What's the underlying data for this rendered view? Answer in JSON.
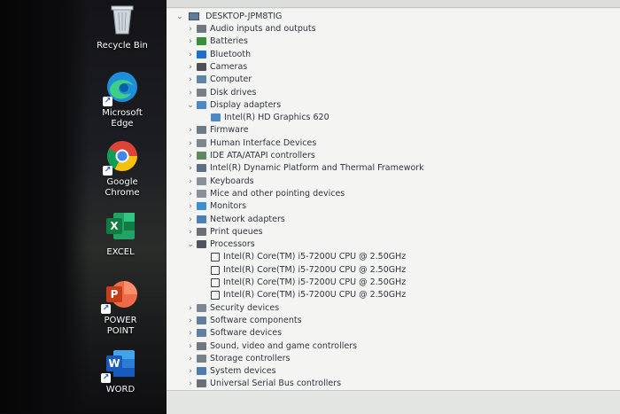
{
  "desktop": {
    "icons": [
      {
        "label": "Recycle Bin",
        "icon": "recycle-bin-icon"
      },
      {
        "label": "Microsoft Edge",
        "icon": "edge-icon"
      },
      {
        "label": "Google Chrome",
        "icon": "chrome-icon"
      },
      {
        "label": "EXCEL",
        "icon": "excel-icon"
      },
      {
        "label": "POWER POINT",
        "icon": "powerpoint-icon"
      },
      {
        "label": "WORD",
        "icon": "word-icon"
      }
    ],
    "edge_lines": [
      "Microsoft",
      "Edge"
    ],
    "chrome_lines": [
      "Google",
      "Chrome"
    ],
    "pp_lines": [
      "POWER",
      "POINT"
    ],
    "excel_letter": "X",
    "pp_letter": "P",
    "word_letter": "W"
  },
  "device_manager": {
    "root": "DESKTOP-JPM8TIG",
    "categories": [
      {
        "label": "Audio inputs and outputs",
        "icon": "speaker-icon",
        "expanded": false
      },
      {
        "label": "Batteries",
        "icon": "battery-icon",
        "expanded": false
      },
      {
        "label": "Bluetooth",
        "icon": "bluetooth-icon",
        "expanded": false
      },
      {
        "label": "Cameras",
        "icon": "camera-icon",
        "expanded": false
      },
      {
        "label": "Computer",
        "icon": "computer-icon",
        "expanded": false
      },
      {
        "label": "Disk drives",
        "icon": "disk-icon",
        "expanded": false
      },
      {
        "label": "Display adapters",
        "icon": "display-icon",
        "expanded": true,
        "children": [
          "Intel(R) HD Graphics 620"
        ]
      },
      {
        "label": "Firmware",
        "icon": "firmware-icon",
        "expanded": false
      },
      {
        "label": "Human Interface Devices",
        "icon": "hid-icon",
        "expanded": false
      },
      {
        "label": "IDE ATA/ATAPI controllers",
        "icon": "ide-icon",
        "expanded": false
      },
      {
        "label": "Intel(R) Dynamic Platform and Thermal Framework",
        "icon": "thermal-icon",
        "expanded": false
      },
      {
        "label": "Keyboards",
        "icon": "keyboard-icon",
        "expanded": false
      },
      {
        "label": "Mice and other pointing devices",
        "icon": "mouse-icon",
        "expanded": false
      },
      {
        "label": "Monitors",
        "icon": "monitor-icon",
        "expanded": false
      },
      {
        "label": "Network adapters",
        "icon": "network-icon",
        "expanded": false
      },
      {
        "label": "Print queues",
        "icon": "printer-icon",
        "expanded": false
      },
      {
        "label": "Processors",
        "icon": "processor-icon",
        "expanded": true,
        "children": [
          "Intel(R) Core(TM) i5-7200U CPU @ 2.50GHz",
          "Intel(R) Core(TM) i5-7200U CPU @ 2.50GHz",
          "Intel(R) Core(TM) i5-7200U CPU @ 2.50GHz",
          "Intel(R) Core(TM) i5-7200U CPU @ 2.50GHz"
        ]
      },
      {
        "label": "Security devices",
        "icon": "security-icon",
        "expanded": false
      },
      {
        "label": "Software components",
        "icon": "software-component-icon",
        "expanded": false
      },
      {
        "label": "Software devices",
        "icon": "software-device-icon",
        "expanded": false
      },
      {
        "label": "Sound, video and game controllers",
        "icon": "sound-icon",
        "expanded": false
      },
      {
        "label": "Storage controllers",
        "icon": "storage-icon",
        "expanded": false
      },
      {
        "label": "System devices",
        "icon": "system-icon",
        "expanded": false
      },
      {
        "label": "Universal Serial Bus controllers",
        "icon": "usb-icon",
        "expanded": false
      }
    ]
  }
}
